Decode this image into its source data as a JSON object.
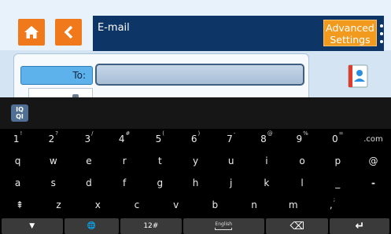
{
  "app": {
    "title": "E-mail",
    "advanced_settings_label": "Advanced\nSettings",
    "to_label": "To:",
    "to_value": "",
    "colors": {
      "accent_orange": "#f07a1b",
      "title_bar": "#0d3566",
      "to_label_bg": "#5eb2ec"
    }
  },
  "icons": {
    "home": "home-icon",
    "back": "chevron-left-icon",
    "more": "more-vertical-icon",
    "contacts": "address-book-icon",
    "iqqi": "iqqi-logo"
  },
  "keyboard": {
    "logo_text": "IQ\nQI",
    "row1": [
      {
        "k": "1",
        "s": "!"
      },
      {
        "k": "2",
        "s": "?"
      },
      {
        "k": "3",
        "s": "/"
      },
      {
        "k": "4",
        "s": "#"
      },
      {
        "k": "5",
        "s": "("
      },
      {
        "k": "6",
        "s": ")"
      },
      {
        "k": "7",
        "s": "-"
      },
      {
        "k": "8",
        "s": "@"
      },
      {
        "k": "9",
        "s": "%"
      },
      {
        "k": "0",
        "s": "="
      },
      {
        "k": ".com",
        "s": ""
      }
    ],
    "row2": [
      "q",
      "w",
      "e",
      "r",
      "t",
      "y",
      "u",
      "i",
      "o",
      "p",
      "@"
    ],
    "row3": [
      "a",
      "s",
      "d",
      "f",
      "g",
      "h",
      "j",
      "k",
      "l",
      "_",
      "-"
    ],
    "row4": [
      "⇞",
      "z",
      "x",
      "c",
      "v",
      "b",
      "n",
      "m",
      ",",
      ""
    ],
    "row4_sup": ";",
    "bottom": {
      "hide_label": "▼",
      "globe_label": "🌐",
      "num_label": "12#",
      "space_label": "English",
      "backspace_label": "⌫",
      "enter_label": "↵"
    }
  }
}
